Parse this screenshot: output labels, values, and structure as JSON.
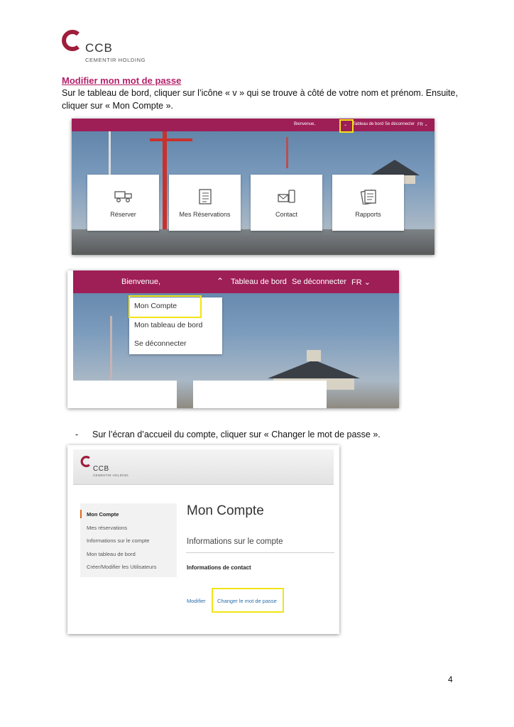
{
  "logo": {
    "brand": "CCB",
    "subtitle": "CEMENTIR HOLDING",
    "color": "#9e1e3c"
  },
  "heading": "Modifier mon mot de passe",
  "instruction": "Sur le tableau de bord, cliquer sur l’icône « v » qui se trouve à côté de votre nom et prénom. Ensuite, cliquer sur « Mon Compte ».",
  "shot1": {
    "nav": {
      "welcome": "Bienvenue,",
      "chevron": "⌄",
      "dashboard": "Tableau de bord",
      "logout": "Se déconnecter",
      "language": "FR ⌄"
    },
    "tiles": [
      {
        "label": "Réserver",
        "icon": "truck-icon"
      },
      {
        "label": "Mes Réservations",
        "icon": "checklist-icon"
      },
      {
        "label": "Contact",
        "icon": "mail-phone-icon"
      },
      {
        "label": "Rapports",
        "icon": "documents-icon"
      }
    ]
  },
  "shot2": {
    "nav": {
      "welcome": "Bienvenue,",
      "chevron": "⌃",
      "dashboard": "Tableau de bord",
      "logout": "Se déconnecter",
      "language": "FR ⌄"
    },
    "menu": [
      "Mon Compte",
      "Mon tableau de bord",
      "Se déconnecter"
    ]
  },
  "bullet": {
    "dash": "-",
    "text": "Sur l’écran d’accueil du compte, cliquer sur « Changer le mot de passe »."
  },
  "shot3": {
    "brand": "CCB",
    "subtitle": "CEMENTIR HOLDING",
    "sidebar": [
      "Mon Compte",
      "Mes réservations",
      "Informations sur le compte",
      "Mon tableau de bord",
      "Créer/Modifier les Utilisateurs"
    ],
    "title": "Mon Compte",
    "section": "Informations sur le compte",
    "contact": "Informations de contact",
    "edit_link": "Modifier",
    "password_link": "Changer le mot de passe"
  },
  "colors": {
    "magenta": "#9e1e56",
    "highlight": "#f2e415",
    "link": "#2b6ea9",
    "heading": "#b3206a"
  },
  "page_number": "4"
}
